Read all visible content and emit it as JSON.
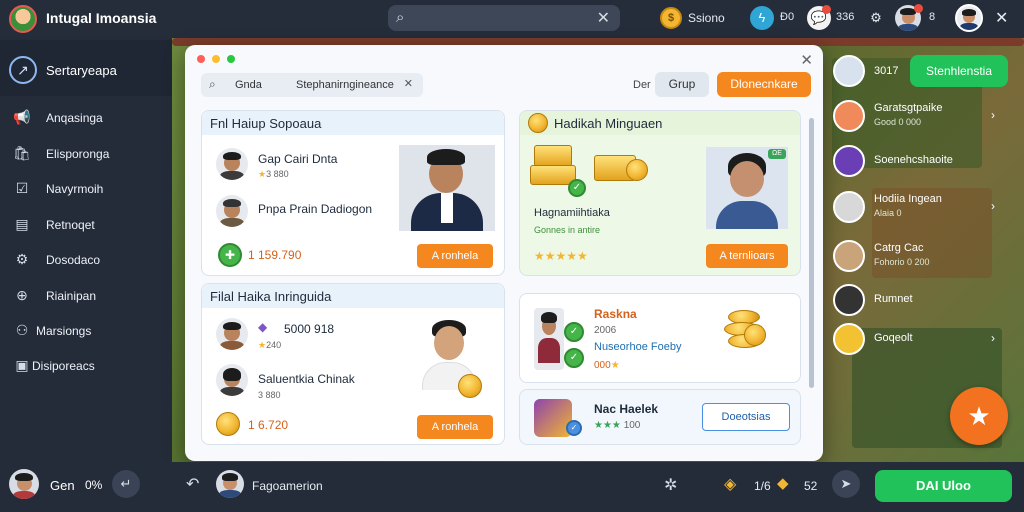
{
  "topbar": {
    "title": "Intugal Imoansia",
    "search_placeholder": "",
    "coins_label": "Ssiono",
    "counter_1": "Ð0",
    "counter_2": "336",
    "counter_3": "8"
  },
  "sidebar": {
    "header_label": "Sertaryeapa",
    "items": [
      {
        "icon": "megaphone-icon",
        "label": "Anqasinga",
        "glyph": "📢"
      },
      {
        "icon": "bag-icon",
        "label": "Elisporonga",
        "glyph": "🛍"
      },
      {
        "icon": "chart-icon",
        "label": "Navyrmoih",
        "glyph": "☑"
      },
      {
        "icon": "document-icon",
        "label": "Retnoqet",
        "glyph": "▤"
      },
      {
        "icon": "settings-icon",
        "label": "Dosodaco",
        "glyph": "⚙"
      },
      {
        "icon": "globe-icon",
        "label": "Riainipan",
        "glyph": "⊕"
      },
      {
        "icon": "group-icon",
        "label": "Marsiongs",
        "glyph": "⚇"
      },
      {
        "icon": "window-icon",
        "label": "Disiporeacs",
        "glyph": "▣"
      }
    ]
  },
  "modal": {
    "search_term_1": "Gnda",
    "search_term_2": "Stephanirngineance",
    "der_label": "Der",
    "grup_button": "Grup",
    "orange_button": "Dlonecnkare",
    "panel_1": {
      "title": "Fnl Haiup Sopoaua",
      "row_1_name": "Gap Cairi Dnta",
      "row_1_sub": "3 880",
      "row_2_name": "Pnpa Prain Dadiogon",
      "price": "1 159.790",
      "button": "A ronhela"
    },
    "panel_2": {
      "title": "Hadikah Minguaen",
      "label": "Hagnamiihtiaka",
      "sub": "Gonnes in antire",
      "button": "A ternlioars",
      "tag": "ΩE"
    },
    "panel_3": {
      "title": "Filal Haika Inringuida",
      "row_1_name": "5000 918",
      "row_1_sub": "240",
      "row_2_name": "Saluentkia Chinak",
      "row_2_sub": "3 880",
      "price": "1 6.720",
      "button": "A ronhela"
    },
    "panel_4": {
      "name": "Raskna",
      "sub1": "2006",
      "sub2": "Nuseorhoe Foeby",
      "sub3": "000"
    },
    "panel_5": {
      "name": "Nac Haelek",
      "sub": "100",
      "button": "Doeotsias"
    }
  },
  "right_column": {
    "top_value": "3017",
    "top_cta": "Stenhlenstia",
    "items": [
      {
        "title": "Garatsgtpaike",
        "sub": "Good 0 000"
      },
      {
        "title": "Soenehcshaoite",
        "sub": ""
      },
      {
        "title": "Hodiia Ingean",
        "sub": "Alaia 0"
      },
      {
        "title": "Catrg Cac",
        "sub": "Fohorio 0 200"
      },
      {
        "title": "Rumnet",
        "sub": ""
      },
      {
        "title": "Goqeolt",
        "sub": ""
      }
    ]
  },
  "bottombar": {
    "user_name": "Gen",
    "user_pct": "0%",
    "label": "Fagoamerion",
    "count_1": "1/6",
    "count_2": "52",
    "cta": "DAI Uloo"
  },
  "colors": {
    "accent_orange": "#f5871f",
    "accent_green": "#22c25a",
    "topbar_bg": "#252d3b"
  }
}
